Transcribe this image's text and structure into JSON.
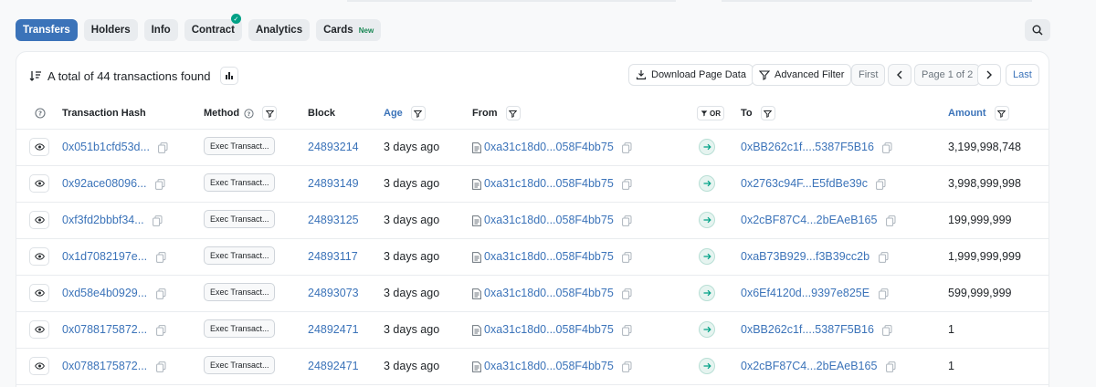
{
  "tabs": [
    {
      "label": "Transfers",
      "active": true
    },
    {
      "label": "Holders"
    },
    {
      "label": "Info"
    },
    {
      "label": "Contract",
      "verified": true
    },
    {
      "label": "Analytics"
    },
    {
      "label": "Cards",
      "badge": "New"
    }
  ],
  "toolbar": {
    "summary": "A total of 44 transactions found",
    "download": "Download Page Data",
    "advanced_filter": "Advanced Filter",
    "first": "First",
    "page": "Page 1 of 2",
    "last": "Last"
  },
  "columns": {
    "hash": "Transaction Hash",
    "method": "Method",
    "block": "Block",
    "age": "Age",
    "from": "From",
    "or": "OR",
    "to": "To",
    "amount": "Amount"
  },
  "rows": [
    {
      "hash": "0x051b1cfd53d...",
      "method": "Exec Transact...",
      "block": "24893214",
      "age": "3 days ago",
      "from": "0xa31c18d0...058F4bb75",
      "to": "0xBB262c1f....5387F5B16",
      "amount": "3,199,998,748"
    },
    {
      "hash": "0x92ace08096...",
      "method": "Exec Transact...",
      "block": "24893149",
      "age": "3 days ago",
      "from": "0xa31c18d0...058F4bb75",
      "to": "0x2763c94F...E5fdBe39c",
      "amount": "3,998,999,998"
    },
    {
      "hash": "0xf3fd2bbbf34...",
      "method": "Exec Transact...",
      "block": "24893125",
      "age": "3 days ago",
      "from": "0xa31c18d0...058F4bb75",
      "to": "0x2cBF87C4...2bEAeB165",
      "amount": "199,999,999"
    },
    {
      "hash": "0x1d7082197e...",
      "method": "Exec Transact...",
      "block": "24893117",
      "age": "3 days ago",
      "from": "0xa31c18d0...058F4bb75",
      "to": "0xaB73B929...f3B39cc2b",
      "amount": "1,999,999,999"
    },
    {
      "hash": "0xd58e4b0929...",
      "method": "Exec Transact...",
      "block": "24893073",
      "age": "3 days ago",
      "from": "0xa31c18d0...058F4bb75",
      "to": "0x6Ef4120d...9397e825E",
      "amount": "599,999,999"
    },
    {
      "hash": "0x0788175872...",
      "method": "Exec Transact...",
      "block": "24892471",
      "age": "3 days ago",
      "from": "0xa31c18d0...058F4bb75",
      "to": "0xBB262c1f....5387F5B16",
      "amount": "1"
    },
    {
      "hash": "0x0788175872...",
      "method": "Exec Transact...",
      "block": "24892471",
      "age": "3 days ago",
      "from": "0xa31c18d0...058F4bb75",
      "to": "0x2cBF87C4...2bEAeB165",
      "amount": "1"
    }
  ],
  "colors": {
    "accent": "#3b73b9",
    "success": "#00a186"
  }
}
